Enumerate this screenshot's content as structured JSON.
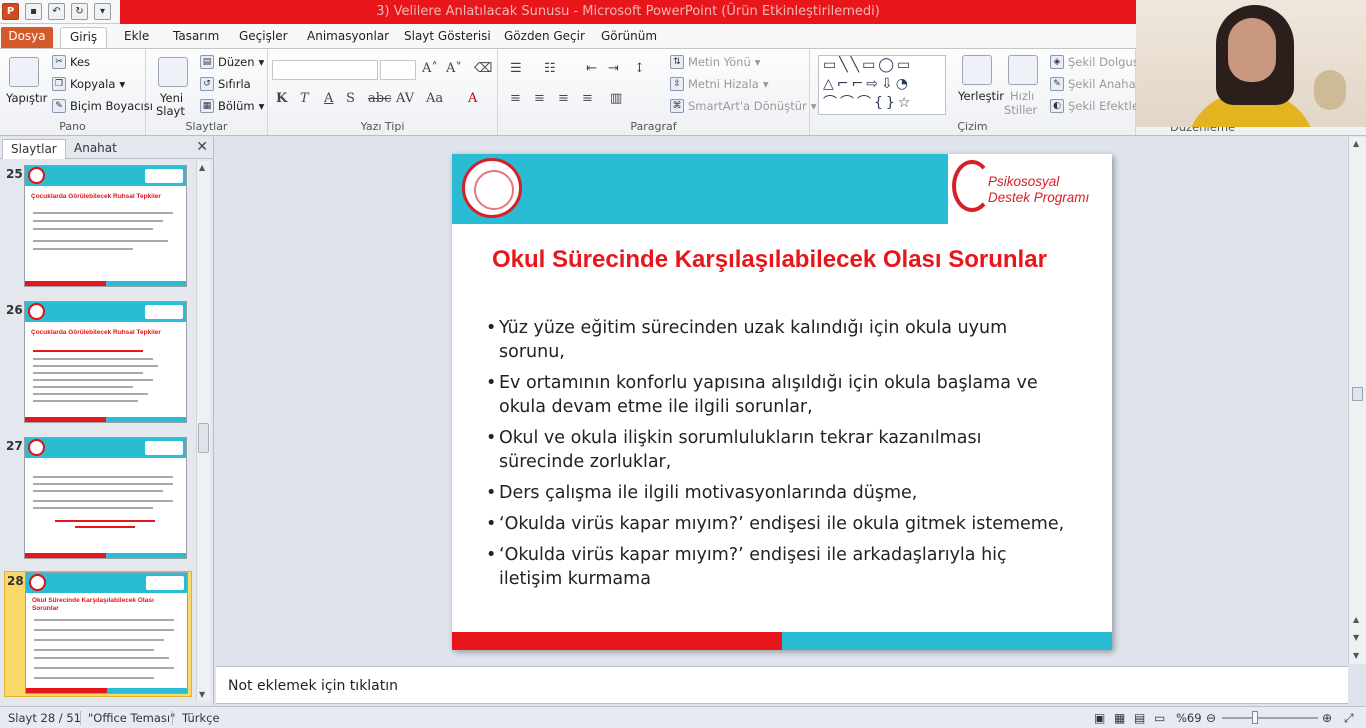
{
  "window": {
    "title": "3) Velilere Anlatılacak Sunusu - Microsoft PowerPoint (Ürün Etkinleştirilemedi)"
  },
  "tabs": [
    {
      "label": "Dosya"
    },
    {
      "label": "Giriş"
    },
    {
      "label": "Ekle"
    },
    {
      "label": "Tasarım"
    },
    {
      "label": "Geçişler"
    },
    {
      "label": "Animasyonlar"
    },
    {
      "label": "Slayt Gösterisi"
    },
    {
      "label": "Gözden Geçir"
    },
    {
      "label": "Görünüm"
    }
  ],
  "ribbon": {
    "pano": {
      "label": "Pano",
      "paste": "Yapıştır",
      "cut": "Kes",
      "copy": "Kopyala",
      "format_painter": "Biçim Boyacısı"
    },
    "slides": {
      "label": "Slaytlar",
      "new_slide_1": "Yeni",
      "new_slide_2": "Slayt",
      "layout": "Düzen",
      "reset": "Sıfırla",
      "section": "Bölüm"
    },
    "font": {
      "label": "Yazı Tipi"
    },
    "paragraph": {
      "label": "Paragraf",
      "text_direction": "Metin Yönü",
      "align_text": "Metni Hizala",
      "smartart": "SmartArt'a Dönüştür"
    },
    "drawing": {
      "label": "Çizim",
      "arrange": "Yerleştir",
      "quick_styles_1": "Hızlı",
      "quick_styles_2": "Stiller",
      "shape_fill": "Şekil Dolgusu",
      "shape_outline": "Şekil Anahattı",
      "shape_effects": "Şekil Efektleri"
    },
    "editing": {
      "label": "Düzenleme"
    }
  },
  "left_panel": {
    "tab_slides": "Slaytlar",
    "tab_outline": "Anahat",
    "thumbnails": [
      {
        "number": "25",
        "title": "Çocuklarda Görülebilecek Ruhsal Tepkiler"
      },
      {
        "number": "26",
        "title": "Çocuklarda Görülebilecek Ruhsal Tepkiler"
      },
      {
        "number": "27",
        "title": ""
      },
      {
        "number": "28",
        "title": "Okul Sürecinde Karşılaşılabilecek Olası Sorunlar"
      }
    ]
  },
  "slide": {
    "logo_text_1": "Psikososyal",
    "logo_text_2": "Destek Programı",
    "title": "Okul Sürecinde Karşılaşılabilecek Olası Sorunlar",
    "bullets": [
      "Yüz yüze eğitim sürecinden uzak kalındığı için okula uyum sorunu,",
      "Ev ortamının konforlu yapısına alışıldığı için okula başlama ve okula devam etme ile ilgili sorunlar,",
      "Okul ve okula ilişkin sorumlulukların tekrar kazanılması sürecinde zorluklar,",
      "Ders çalışma ile ilgili motivasyonlarında düşme,",
      "‘Okulda virüs kapar mıyım?’ endişesi ile okula gitmek istememe,",
      "‘Okulda virüs kapar mıyım?’ endişesi ile arkadaşlarıyla hiç iletişim kurmama"
    ]
  },
  "notes": {
    "placeholder": "Not eklemek için tıklatın"
  },
  "status": {
    "slide": "Slayt 28 / 51",
    "theme": "\"Office Teması\"",
    "language": "Türkçe",
    "zoom": "%69"
  },
  "colors": {
    "accent_red": "#e8161b",
    "accent_cyan": "#29bcd3",
    "file_tab": "#d35b2b"
  }
}
